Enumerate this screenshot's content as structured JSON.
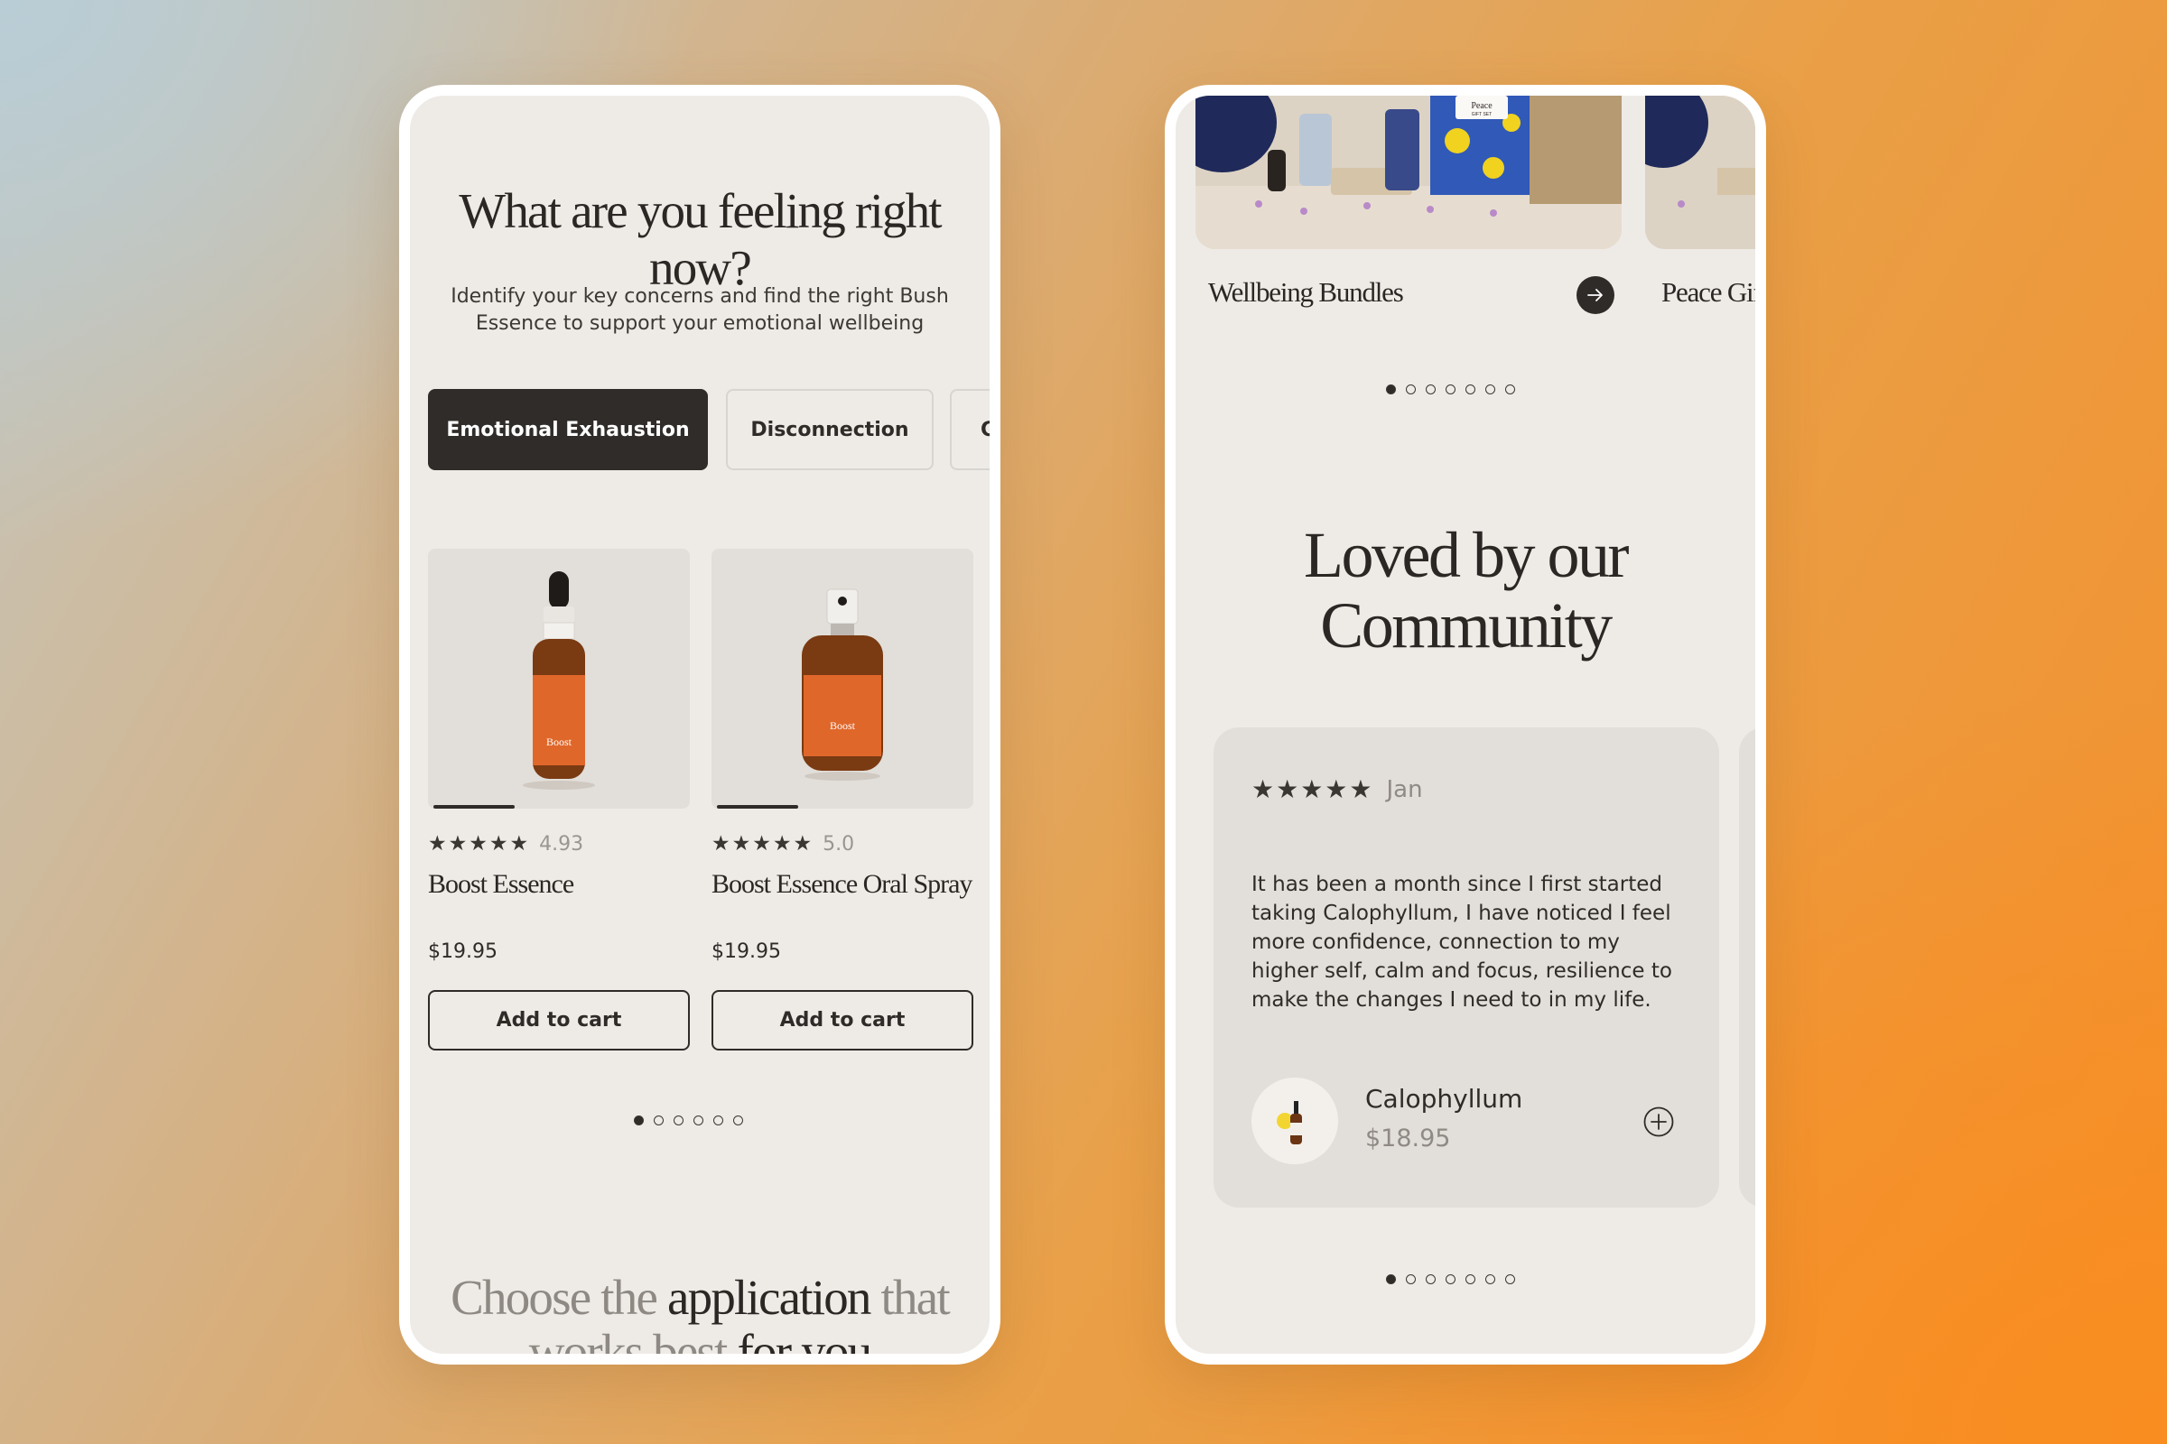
{
  "left_screen": {
    "title": "What are you feeling right now?",
    "subtitle": "Identify your key concerns and find the right Bush Essence to support your emotional wellbeing",
    "chips": [
      {
        "label": "Emotional Exhaustion",
        "active": true
      },
      {
        "label": "Disconnection",
        "active": false
      },
      {
        "label": "C",
        "active": false
      }
    ],
    "products": [
      {
        "stars": "★★★★★",
        "rating": "4.93",
        "name": "Boost Essence",
        "price": "$19.95",
        "cta": "Add to cart",
        "icon": "dropper-bottle",
        "bottle_label": "Boost"
      },
      {
        "stars": "★★★★★",
        "rating": "5.0",
        "name": "Boost Essence Oral Spray",
        "price": "$19.95",
        "cta": "Add to cart",
        "icon": "spray-bottle",
        "bottle_label": "Boost"
      }
    ],
    "carousel": {
      "count": 6,
      "active_index": 0
    },
    "bottom_heading": {
      "part1": "Choose the ",
      "part2": "application",
      "part3": " that",
      "line2a": "works best ",
      "line2b": "for you"
    }
  },
  "right_screen": {
    "bundles": [
      {
        "name": "Wellbeing Bundles",
        "image_caption": "Peace",
        "image_subcaption": "GIFT SET"
      },
      {
        "name": "Peace Gift"
      }
    ],
    "bundle_carousel": {
      "count": 7,
      "active_index": 0
    },
    "section_title_line1": "Loved by our",
    "section_title_line2": "Community",
    "review": {
      "stars": "★★★★★",
      "author": "Jan",
      "text": "It has been a month since I first started taking Calophyllum, I have noticed I feel more confidence, connection to my higher self, calm and focus, resilience to make the changes I need to in my life.",
      "product_name": "Calophyllum",
      "product_price": "$18.95"
    },
    "review_carousel": {
      "count": 7,
      "active_index": 0
    }
  },
  "colors": {
    "dark": "#2f2b28",
    "screen_bg": "#eeebe7",
    "card_bg": "#e2ded9",
    "bottle_orange": "#e0672a",
    "muted_text": "#8f8a84"
  }
}
